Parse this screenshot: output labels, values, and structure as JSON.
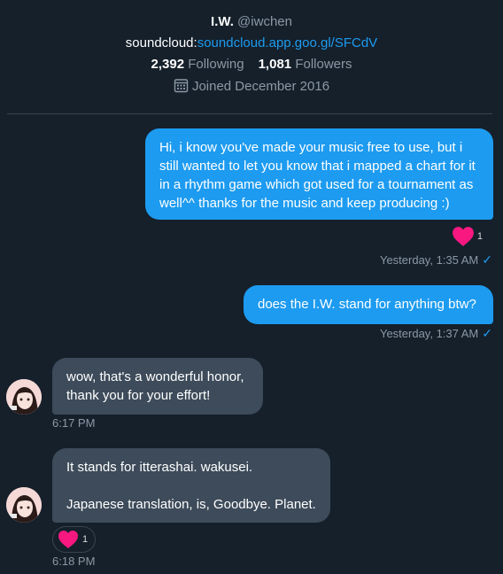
{
  "profile": {
    "display_name": "I.W.",
    "handle": "@iwchen",
    "bio_prefix": "soundcloud:",
    "bio_link": "soundcloud.app.goo.gl/SFCdV",
    "following_count": "2,392",
    "following_label": "Following",
    "followers_count": "1,081",
    "followers_label": "Followers",
    "joined": "Joined December 2016"
  },
  "messages": [
    {
      "direction": "out",
      "text": "Hi, i know you've made your music free to use, but i still wanted to let you know that i mapped a chart for it in a rhythm game which got used for a tournament as well^^ thanks for the music and keep producing :)",
      "reaction_count": "1",
      "timestamp": "Yesterday, 1:35 AM"
    },
    {
      "direction": "out",
      "text": "does the I.W. stand for anything btw?",
      "timestamp": "Yesterday, 1:37 AM"
    },
    {
      "direction": "in",
      "text_line1": "wow, that's a wonderful honor,",
      "text_line2": "thank you for your effort!",
      "timestamp": "6:17 PM"
    },
    {
      "direction": "in",
      "text_line1": "It stands for itterashai. wakusei.",
      "text_line2": "Japanese translation, is, Goodbye. Planet.",
      "reaction_count": "1",
      "timestamp": "6:18 PM"
    }
  ],
  "colors": {
    "background": "#15202b",
    "outgoing_bubble": "#1d9bf0",
    "incoming_bubble": "#3d4b5a",
    "heart": "#f91880",
    "link": "#1d9bf0"
  }
}
